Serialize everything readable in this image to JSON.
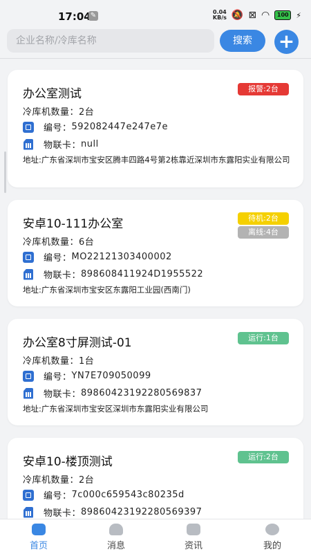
{
  "status_bar": {
    "time": "17:04",
    "net_speed_value": "0.04",
    "net_speed_unit": "KB/s",
    "battery": "100"
  },
  "search": {
    "placeholder": "企业名称/冷库名称",
    "button_label": "搜索",
    "add_label": "+"
  },
  "labels": {
    "device_count_prefix": "冷库机数量：",
    "serial_prefix": "编号：",
    "sim_prefix": "物联卡："
  },
  "cards": [
    {
      "name": "办公室测试",
      "device_count": "2台",
      "serial": "592082447e247e7e",
      "sim": "null",
      "address": "地址:广东省深圳市宝安区腾丰四路4号第2栋靠近深圳市东露阳实业有限公司",
      "badges": [
        {
          "text": "报警:2台",
          "color": "#e53935"
        }
      ]
    },
    {
      "name": "安卓10-111办公室",
      "device_count": "6台",
      "serial": "MO22121303400002",
      "sim": "898608411924D1955522",
      "address": "地址:广东省深圳市宝安区东露阳工业园(西南门)",
      "badges": [
        {
          "text": "待机:2台",
          "color": "#f5d000"
        },
        {
          "text": "离线:4台",
          "color": "#b3b3b3"
        }
      ]
    },
    {
      "name": "办公室8寸屏测试-01",
      "device_count": "1台",
      "serial": "YN7E709050099",
      "sim": "89860423192280569837",
      "address": "地址:广东省深圳市宝安区深圳市东露阳实业有限公司",
      "badges": [
        {
          "text": "运行:1台",
          "color": "#5fc28f"
        }
      ]
    },
    {
      "name": "安卓10-楼顶测试",
      "device_count": "2台",
      "serial": "7c000c659543c80235d",
      "sim": "89860423192280569397",
      "address": "",
      "badges": [
        {
          "text": "运行:2台",
          "color": "#5fc28f"
        }
      ]
    }
  ],
  "tabs": [
    {
      "label": "首页",
      "icon": "home-icon",
      "active": true
    },
    {
      "label": "消息",
      "icon": "message-icon",
      "active": false
    },
    {
      "label": "资讯",
      "icon": "news-icon",
      "active": false
    },
    {
      "label": "我的",
      "icon": "profile-icon",
      "active": false
    }
  ],
  "colors": {
    "accent": "#3a87e3",
    "tab_active": "#3a87e3",
    "tab_inactive": "#666666",
    "tab_icon_inactive": "#b8bcc2",
    "device_icon": "#2f6fd1"
  }
}
